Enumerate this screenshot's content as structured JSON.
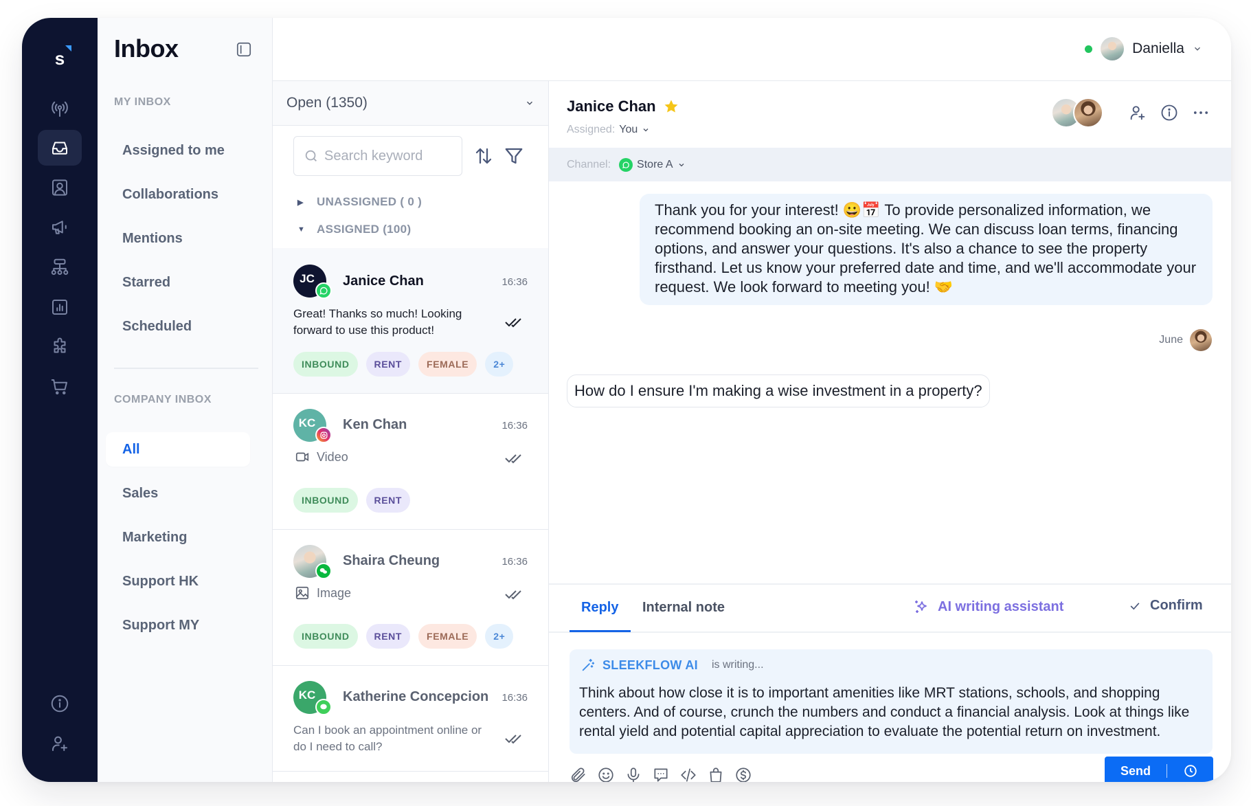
{
  "app": {
    "logo_letter": "s",
    "colors": {
      "rail_bg": "#0d1430",
      "accent": "#1463e6",
      "send": "#0b6cf5",
      "online": "#22c55e",
      "ai_purple": "#7c6fe0"
    }
  },
  "rail": {
    "items": [
      {
        "icon": "broadcast-icon",
        "active": false
      },
      {
        "icon": "inbox-icon",
        "active": true
      },
      {
        "icon": "contacts-icon",
        "active": false
      },
      {
        "icon": "megaphone-icon",
        "active": false
      },
      {
        "icon": "flow-builder-icon",
        "active": false
      },
      {
        "icon": "analytics-icon",
        "active": false
      },
      {
        "icon": "integrations-icon",
        "active": false
      },
      {
        "icon": "commerce-cart-icon",
        "active": false
      }
    ],
    "bottom_items": [
      {
        "icon": "info-icon"
      },
      {
        "icon": "invite-user-icon"
      }
    ]
  },
  "inbox_panel": {
    "title": "Inbox",
    "my_inbox_label": "MY INBOX",
    "my_inbox_items": [
      "Assigned to me",
      "Collaborations",
      "Mentions",
      "Starred",
      "Scheduled"
    ],
    "company_inbox_label": "COMPANY INBOX",
    "company_inbox_items": [
      "All",
      "Sales",
      "Marketing",
      "Support HK",
      "Support MY"
    ],
    "active_item": "All"
  },
  "user_menu": {
    "name": "Daniella",
    "status": "online"
  },
  "conversation_list": {
    "status_filter": "Open (1350)",
    "search_placeholder": "Search keyword",
    "search_value": "",
    "groups": {
      "unassigned": "UNASSIGNED ( 0 )",
      "assigned": "ASSIGNED (100)"
    },
    "conversations": [
      {
        "initials": "JC",
        "name": "Janice Chan",
        "time": "16:36",
        "channel": "whatsapp",
        "preview": "Great! Thanks so much! Looking forward to use this product!",
        "tags": [
          "INBOUND",
          "RENT",
          "FEMALE",
          "2+"
        ],
        "selected": true,
        "avatar_color": "#0f1430"
      },
      {
        "initials": "KC",
        "name": "Ken Chan",
        "time": "16:36",
        "channel": "instagram",
        "media": "Video",
        "tags": [
          "INBOUND",
          "RENT"
        ],
        "selected": false,
        "avatar_color": "#5fb3a6"
      },
      {
        "initials": "",
        "name": "Shaira Cheung",
        "time": "16:36",
        "channel": "wechat",
        "media": "Image",
        "tags": [
          "INBOUND",
          "RENT",
          "FEMALE",
          "2+"
        ],
        "selected": false,
        "avatar_photo": true
      },
      {
        "initials": "KC",
        "name": "Katherine Concepcion",
        "time": "16:36",
        "channel": "sms",
        "preview": "Can I book an appointment online or do I need to call?",
        "tags": [],
        "selected": false,
        "avatar_color": "#3aa76a"
      }
    ]
  },
  "chat": {
    "contact_name": "Janice Chan",
    "starred": true,
    "assigned_label": "Assigned:",
    "assigned_value": "You",
    "channel_label": "Channel:",
    "channel_value": "Store A",
    "messages": [
      {
        "direction": "outgoing",
        "text": "Thank you for your interest! 😀📅  To provide personalized information, we recommend booking an on-site meeting. We can discuss loan terms, financing options, and answer your questions. It's also a chance to see the property firsthand. Let us know your preferred date and time, and we'll accommodate your request. We look forward to meeting you! 🤝",
        "sender": "June"
      },
      {
        "direction": "incoming",
        "text": "How do I ensure I'm making a wise investment in a property?"
      }
    ]
  },
  "composer": {
    "tabs": [
      "Reply",
      "Internal note"
    ],
    "active_tab": "Reply",
    "ai_button": "AI writing assistant",
    "confirm_button": "Confirm",
    "ai_brand": "SLEEKFLOW AI",
    "ai_status": "is writing...",
    "ai_text": "Think about how close it is to important amenities like MRT stations, schools, and shopping centers. And of course, crunch the numbers and conduct a financial analysis. Look at things like rental yield and potential capital appreciation to evaluate the potential return on investment.",
    "toolbar": [
      "attachment-icon",
      "emoji-icon",
      "microphone-icon",
      "quick-reply-icon",
      "template-code-icon",
      "shopping-bag-icon",
      "payment-link-icon"
    ],
    "send_label": "Send"
  }
}
